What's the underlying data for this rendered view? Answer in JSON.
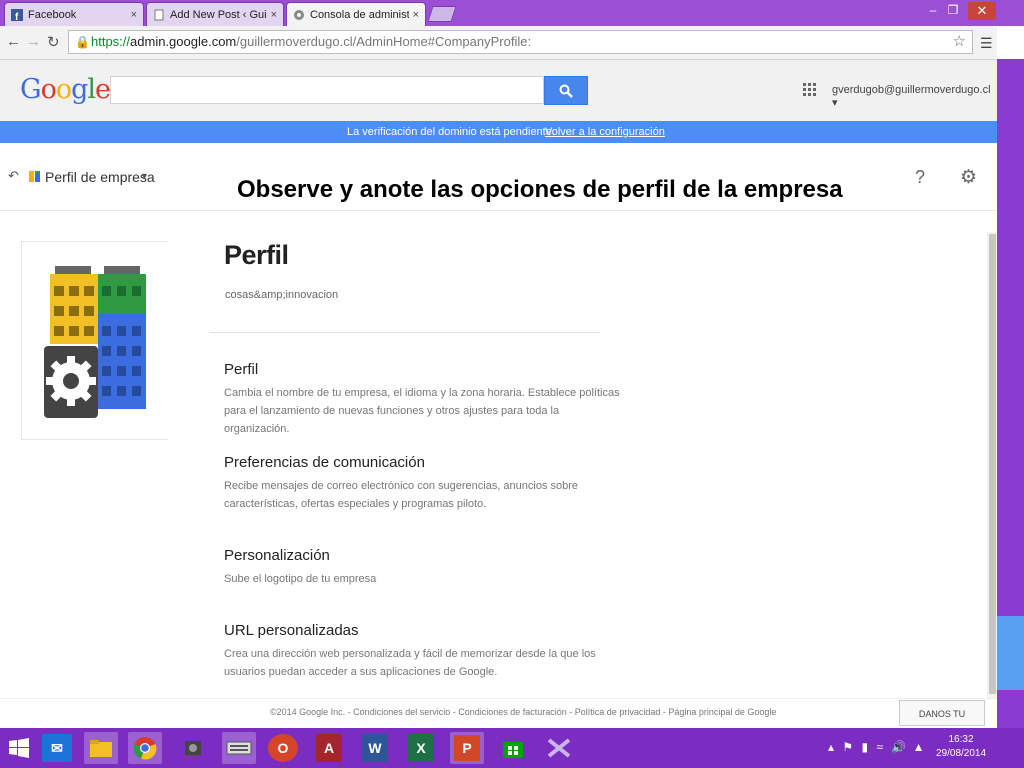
{
  "browser": {
    "tabs": [
      {
        "title": "Facebook",
        "icon": "facebook-icon"
      },
      {
        "title": "Add New Post ‹ Guillermo",
        "icon": "page-icon"
      },
      {
        "title": "Consola de administración",
        "icon": "admin-icon"
      }
    ],
    "close_glyph": "×",
    "url_scheme": "https://",
    "url_host": "admin.google.com",
    "url_path": "/guillermoverdugo.cl/AdminHome#CompanyProfile:"
  },
  "google_bar": {
    "logo": [
      "G",
      "o",
      "o",
      "g",
      "l",
      "e"
    ],
    "search_placeholder": "",
    "account": "gverdugob@guillermoverdugo.cl"
  },
  "notice": {
    "text": "La verificación del dominio está pendiente.",
    "link": "Volver a la configuración"
  },
  "header": {
    "breadcrumb": "Perfil de empresa",
    "overlay_title": "Observe y anote las opciones de perfil de la empresa",
    "help": "?"
  },
  "main": {
    "title": "Perfil",
    "subtitle": "cosas&amp;innovacion",
    "sections": [
      {
        "heading": "Perfil",
        "desc": "Cambia el nombre de tu empresa, el idioma y la zona horaria. Establece políticas para el lanzamiento de nuevas funciones y otros ajustes para toda la organización."
      },
      {
        "heading": "Preferencias de comunicación",
        "desc": "Recibe mensajes de correo electrónico con sugerencias, anuncios sobre características, ofertas especiales y programas piloto."
      },
      {
        "heading": "Personalización",
        "desc": "Sube el logotipo de tu empresa"
      },
      {
        "heading": "URL personalizadas",
        "desc": "Crea una dirección web personalizada y fácil de memorizar desde la que los usuarios puedan acceder a sus aplicaciones de Google."
      }
    ]
  },
  "footer": {
    "links": "©2014 Google Inc. - Condiciones del servicio - Condiciones de facturación - Política de privacidad - Página principal de Google",
    "feedback": "DANOS TU OPINIÓN"
  },
  "taskbar": {
    "time": "16:32",
    "date": "29/08/2014",
    "apps": [
      "windows-start",
      "mail",
      "file-explorer",
      "chrome",
      "app",
      "keyboard",
      "opera",
      "access",
      "word",
      "excel",
      "powerpoint",
      "store",
      "visual-studio"
    ]
  },
  "colors": {
    "notice_bar": "#4c8ef6",
    "title_bar": "#9a4fd4",
    "taskbar": "#7b2cc1",
    "search_button": "#4787ed"
  }
}
